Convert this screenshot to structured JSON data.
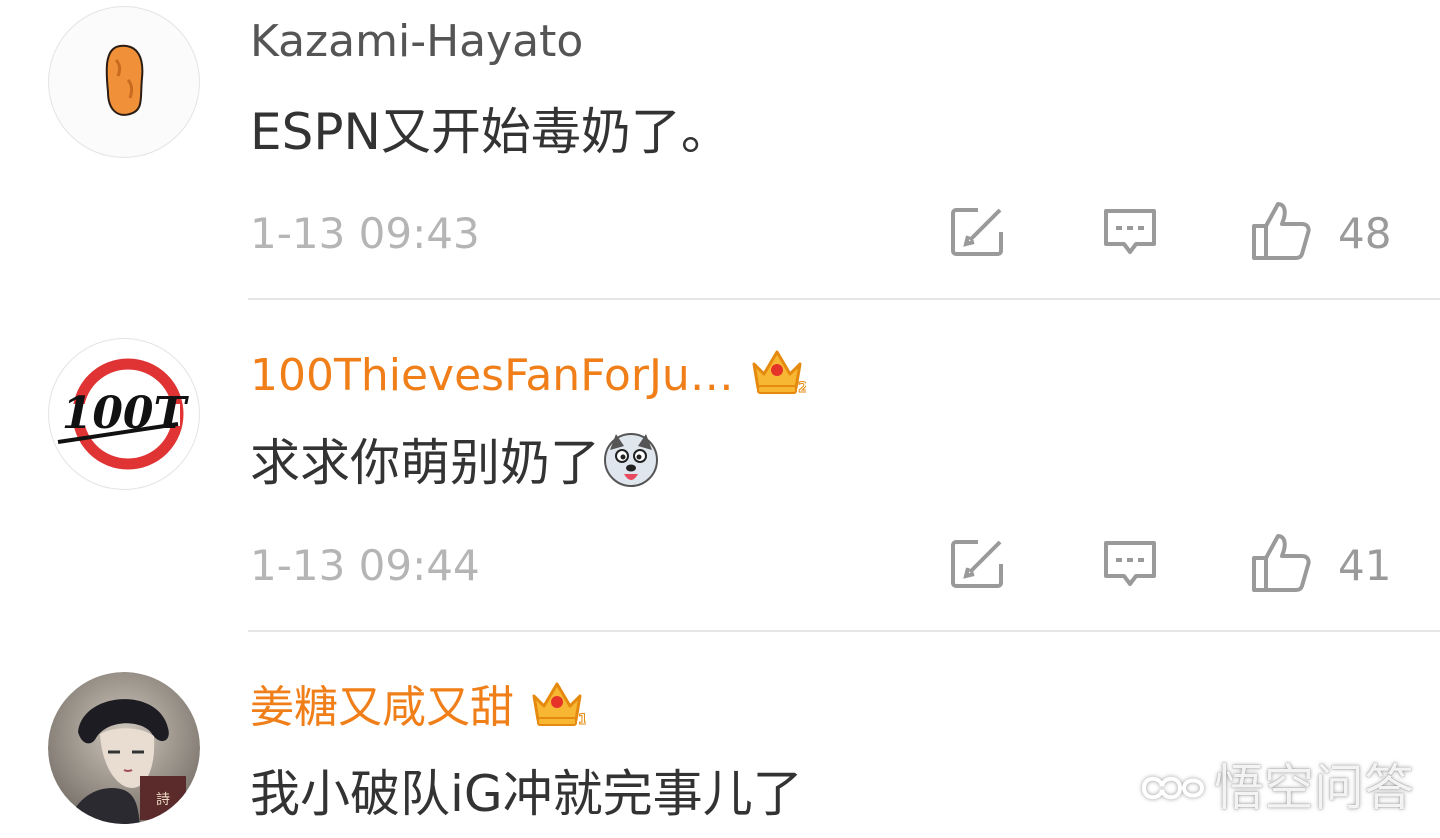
{
  "comments": [
    {
      "username": "Kazami-Hayato",
      "text": "ESPN又开始毒奶了。",
      "time": "1-13 09:43",
      "likes": "48",
      "avatar_icon": "orange-nugget-avatar"
    },
    {
      "username": "100ThievesFanForJu…",
      "text": "求求你萌别奶了",
      "time": "1-13 09:44",
      "likes": "41",
      "vip_badge": "crown-level-2-icon",
      "avatar_icon": "100-thieves-logo-avatar",
      "emoji": "husky-dog-emoji"
    },
    {
      "username": "姜糖又咸又甜",
      "text": "我小破队iG冲就完事儿了",
      "vip_badge": "crown-level-1-icon",
      "avatar_icon": "anime-character-avatar"
    }
  ],
  "watermark": {
    "text": "悟空问答",
    "icon": "wukong-logo-icon"
  },
  "colors": {
    "vip_name": "#f07f1a",
    "plain_name": "#555555",
    "meta": "#b5b5b5",
    "icon": "#9a9a9a"
  }
}
